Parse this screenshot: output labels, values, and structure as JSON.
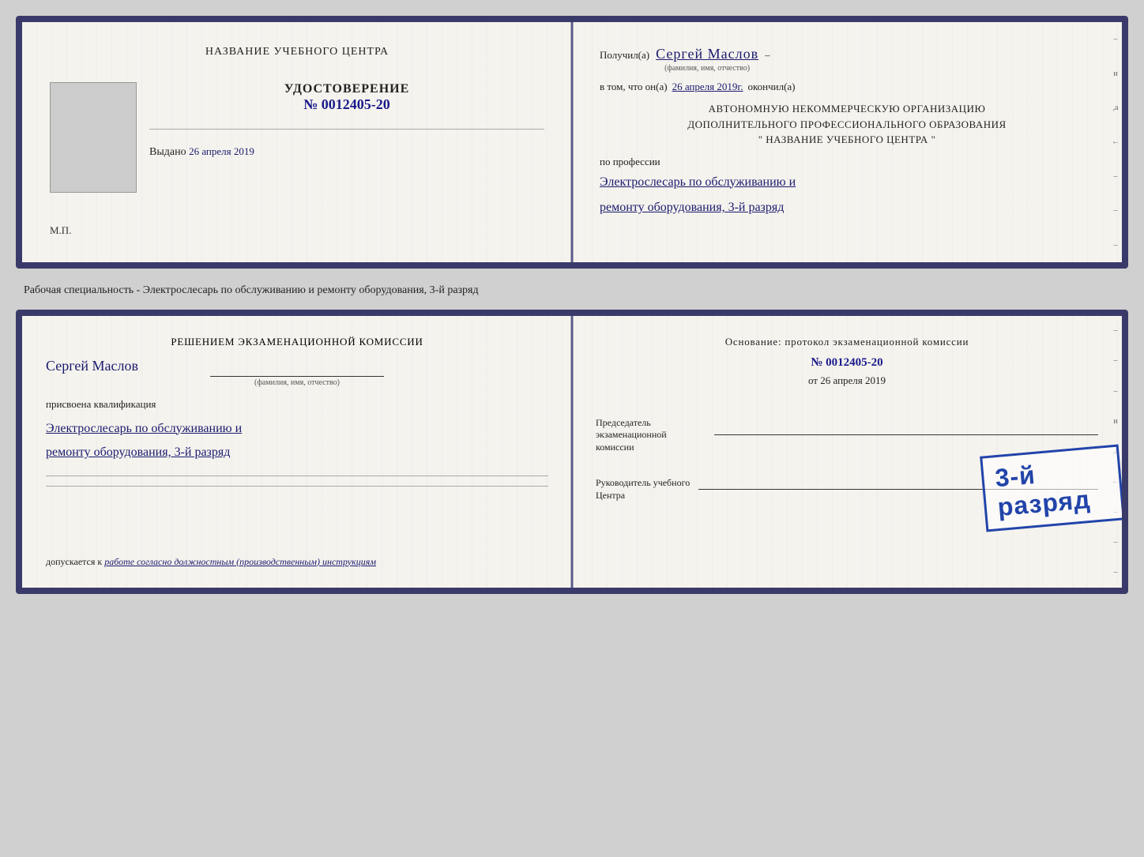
{
  "doc1": {
    "left": {
      "center_title": "НАЗВАНИЕ УЧЕБНОГО ЦЕНТРА",
      "udost_title": "УДОСТОВЕРЕНИЕ",
      "udost_number": "№ 0012405-20",
      "vydano_label": "Выдано",
      "vydano_date": "26 апреля 2019",
      "mp_label": "М.П."
    },
    "right": {
      "poluchil_label": "Получил(а)",
      "recipient_name": "Сергей Маслов",
      "fio_hint": "(фамилия, имя, отчество)",
      "dash": "–",
      "vtom_label": "в том, что он(а)",
      "vtom_date": "26 апреля 2019г.",
      "okonchil_label": "окончил(а)",
      "org_line1": "АВТОНОМНУЮ НЕКОММЕРЧЕСКУЮ ОРГАНИЗАЦИЮ",
      "org_line2": "ДОПОЛНИТЕЛЬНОГО ПРОФЕССИОНАЛЬНОГО ОБРАЗОВАНИЯ",
      "org_line3": "\"     НАЗВАНИЕ УЧЕБНОГО ЦЕНТРА     \"",
      "poprofessii_label": "по профессии",
      "profession_line1": "Электрослесарь по обслуживанию и",
      "profession_line2": "ремонту оборудования, 3-й разряд"
    }
  },
  "between_label": "Рабочая специальность - Электрослесарь по обслуживанию и ремонту оборудования, 3-й разряд",
  "doc2": {
    "left": {
      "resheniyem_label": "Решением экзаменационной комиссии",
      "person_name": "Сергей Маслов",
      "fio_hint": "(фамилия, имя, отчество)",
      "prisvoena_label": "присвоена квалификация",
      "kvalif_line1": "Электрослесарь по обслуживанию и",
      "kvalif_line2": "ремонту оборудования, 3-й разряд",
      "dopuskaetsya_label": "допускается к",
      "dopuskaetsya_text": "работе согласно должностным (производственным) инструкциям"
    },
    "right": {
      "osnovaniye_label": "Основание: протокол экзаменационной комиссии",
      "protocol_number": "№  0012405-20",
      "ot_label": "от",
      "ot_date": "26 апреля 2019",
      "predsedatel_label": "Председатель экзаменационной комиссии",
      "rukovoditel_label": "Руководитель учебного Центра"
    },
    "stamp": "3-й разряд"
  }
}
